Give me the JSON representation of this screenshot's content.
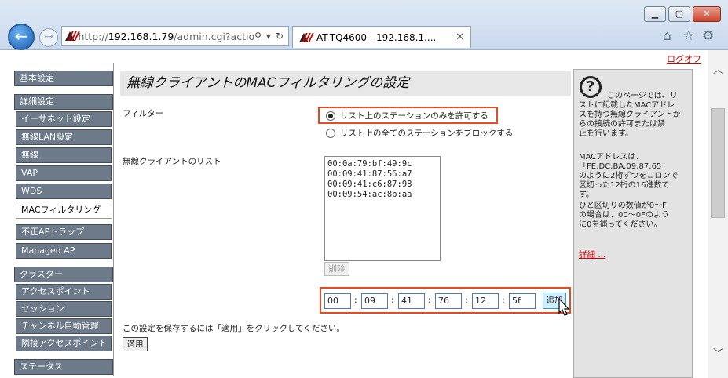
{
  "browser": {
    "url_prefix": "http://",
    "url_host": "192.168.1.79",
    "url_path": "/admin.cgi?actio",
    "tab_title": "AT-TQ4600 - 192.168.1....",
    "minimize": "▁",
    "maximize": "▢",
    "close": "✕"
  },
  "header": {
    "logoff": "ログオフ"
  },
  "sidebar": {
    "items": [
      {
        "label": "基本設定"
      },
      {
        "label": "詳細設定"
      },
      {
        "label": "イーサネット設定"
      },
      {
        "label": "無線LAN設定"
      },
      {
        "label": "無線"
      },
      {
        "label": "VAP"
      },
      {
        "label": "WDS"
      },
      {
        "label": "MACフィルタリング"
      },
      {
        "label": "不正APトラップ"
      },
      {
        "label": "Managed AP"
      },
      {
        "label": "クラスター"
      },
      {
        "label": "アクセスポイント"
      },
      {
        "label": "セッション"
      },
      {
        "label": "チャンネル自動管理"
      },
      {
        "label": "隣接アクセスポイント"
      },
      {
        "label": "ステータス"
      }
    ]
  },
  "main": {
    "title": "無線クライアントのMACフィルタリングの設定",
    "filter_label": "フィルター",
    "radio_allow": "リスト上のステーションのみを許可する",
    "radio_block": "リスト上の全てのステーションをブロックする",
    "list_label": "無線クライアントのリスト",
    "mac_list": [
      "00:0a:79:bf:49:9c",
      "00:09:41:87:56:a7",
      "00:09:41:c6:87:98",
      "00:09:54:ac:8b:aa"
    ],
    "delete_button": "削除",
    "mac_input": [
      "00",
      "09",
      "41",
      "76",
      "12",
      "5f"
    ],
    "add_button": "追加",
    "save_note": "この設定を保存するには「適用」をクリックしてください。",
    "apply_button": "適用"
  },
  "help": {
    "line1": "このページでは、リ",
    "line2": "ストに記載したMACアドレ",
    "line3": "スを持つ無線クライアントか",
    "line4": "らの接続の許可または禁",
    "line5": "止を行います。",
    "p2_1": "MACアドレスは、",
    "p2_2": "「FE:DC:BA:09:87:65」",
    "p2_3": "のように2桁ずつをコロンで",
    "p2_4": "区切った12桁の16進数で",
    "p2_5": "す。",
    "p3_1": "ひと区切りの数値が0～F",
    "p3_2": "の場合は、00～0Fのよう",
    "p3_3": "に0を補ってください。",
    "more": "詳細 ..."
  }
}
